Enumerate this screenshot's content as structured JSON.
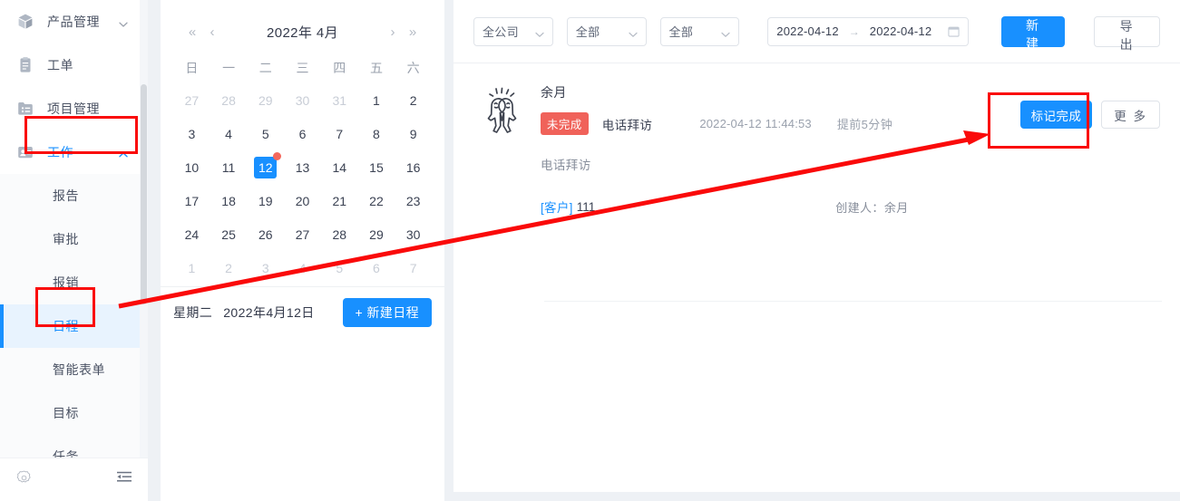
{
  "sidebar": {
    "items": [
      {
        "label": "产品管理",
        "icon": "cube-icon",
        "expandable": true,
        "expanded": false
      },
      {
        "label": "工单",
        "icon": "clipboard-icon",
        "expandable": false
      },
      {
        "label": "项目管理",
        "icon": "folder-list-icon",
        "expandable": false
      },
      {
        "label": "工作",
        "icon": "id-card-icon",
        "expandable": true,
        "expanded": true,
        "active": true
      }
    ],
    "sub_items": [
      {
        "label": "报告"
      },
      {
        "label": "审批"
      },
      {
        "label": "报销"
      },
      {
        "label": "日程",
        "selected": true
      },
      {
        "label": "智能表单"
      },
      {
        "label": "目标"
      },
      {
        "label": "任务"
      }
    ],
    "footer": {
      "settings_icon": "gear-icon",
      "collapse_icon": "menu-collapse-icon"
    }
  },
  "calendar": {
    "nav": {
      "prev_year": "«",
      "prev_month": "‹",
      "next_month": "›",
      "next_year": "»"
    },
    "title": "2022年 4月",
    "weekdays": [
      "日",
      "一",
      "二",
      "三",
      "四",
      "五",
      "六"
    ],
    "weeks": [
      [
        {
          "d": "27",
          "out": true
        },
        {
          "d": "28",
          "out": true
        },
        {
          "d": "29",
          "out": true
        },
        {
          "d": "30",
          "out": true
        },
        {
          "d": "31",
          "out": true
        },
        {
          "d": "1"
        },
        {
          "d": "2"
        }
      ],
      [
        {
          "d": "3"
        },
        {
          "d": "4"
        },
        {
          "d": "5"
        },
        {
          "d": "6"
        },
        {
          "d": "7"
        },
        {
          "d": "8"
        },
        {
          "d": "9"
        }
      ],
      [
        {
          "d": "10"
        },
        {
          "d": "11"
        },
        {
          "d": "12",
          "today": true,
          "dot": true
        },
        {
          "d": "13"
        },
        {
          "d": "14"
        },
        {
          "d": "15"
        },
        {
          "d": "16"
        }
      ],
      [
        {
          "d": "17"
        },
        {
          "d": "18"
        },
        {
          "d": "19"
        },
        {
          "d": "20"
        },
        {
          "d": "21"
        },
        {
          "d": "22"
        },
        {
          "d": "23"
        }
      ],
      [
        {
          "d": "24"
        },
        {
          "d": "25"
        },
        {
          "d": "26"
        },
        {
          "d": "27"
        },
        {
          "d": "28"
        },
        {
          "d": "29"
        },
        {
          "d": "30"
        }
      ],
      [
        {
          "d": "1",
          "out": true
        },
        {
          "d": "2",
          "out": true
        },
        {
          "d": "3",
          "out": true
        },
        {
          "d": "4",
          "out": true
        },
        {
          "d": "5",
          "out": true
        },
        {
          "d": "6",
          "out": true
        },
        {
          "d": "7",
          "out": true
        }
      ]
    ],
    "footer": {
      "weekday": "星期二",
      "date": "2022年4月12日",
      "new_button": "+ 新建日程"
    }
  },
  "toolbar": {
    "scope_select": {
      "value": "全公司",
      "icon": "chevron-down-icon"
    },
    "filter_one": {
      "value": "全部",
      "icon": "chevron-down-icon"
    },
    "filter_two": {
      "value": "全部",
      "icon": "chevron-down-icon"
    },
    "date_range": {
      "start": "2022-04-12",
      "separator": "→",
      "end": "2022-04-12",
      "icon": "calendar-icon"
    },
    "new_button": "新 建",
    "export_button": "导 出"
  },
  "schedule_card": {
    "avatar_icon": "two-people-celebrating-icon",
    "owner": "余月",
    "status_badge": "未完成",
    "type": "电话拜访",
    "time": "2022-04-12 11:44:53",
    "reminder": "提前5分钟",
    "description": "电话拜访",
    "tag_label": "[客户]",
    "tag_value": "111",
    "creator": "创建人：余月",
    "mark_done_button": "标记完成",
    "more_button": "更 多"
  },
  "annotations": {
    "highlight_color": "#fa0a0a",
    "boxes": [
      {
        "name": "work-nav-highlight"
      },
      {
        "name": "schedule-subnav-highlight"
      },
      {
        "name": "mark-done-highlight"
      }
    ],
    "arrow": {
      "from": "日程",
      "to": "标记完成"
    }
  }
}
